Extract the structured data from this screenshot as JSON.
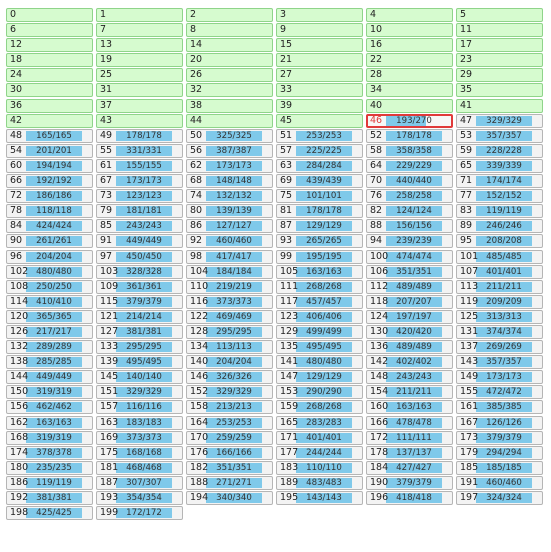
{
  "colors": {
    "done_bg": "#d6fbcf",
    "done_border": "#8fd48a",
    "active_border": "#e03a3a",
    "bar_fill": "#7fc9ea",
    "cell_bg": "#f3f3f3"
  },
  "cells": [
    {
      "id": "0",
      "status": "done"
    },
    {
      "id": "1",
      "status": "done"
    },
    {
      "id": "2",
      "status": "done"
    },
    {
      "id": "3",
      "status": "done"
    },
    {
      "id": "4",
      "status": "done"
    },
    {
      "id": "5",
      "status": "done"
    },
    {
      "id": "6",
      "status": "done"
    },
    {
      "id": "7",
      "status": "done"
    },
    {
      "id": "8",
      "status": "done"
    },
    {
      "id": "9",
      "status": "done"
    },
    {
      "id": "10",
      "status": "done"
    },
    {
      "id": "11",
      "status": "done"
    },
    {
      "id": "12",
      "status": "done"
    },
    {
      "id": "13",
      "status": "done"
    },
    {
      "id": "14",
      "status": "done"
    },
    {
      "id": "15",
      "status": "done"
    },
    {
      "id": "16",
      "status": "done"
    },
    {
      "id": "17",
      "status": "done"
    },
    {
      "id": "18",
      "status": "done"
    },
    {
      "id": "19",
      "status": "done"
    },
    {
      "id": "20",
      "status": "done"
    },
    {
      "id": "21",
      "status": "done"
    },
    {
      "id": "22",
      "status": "done"
    },
    {
      "id": "23",
      "status": "done"
    },
    {
      "id": "24",
      "status": "done"
    },
    {
      "id": "25",
      "status": "done"
    },
    {
      "id": "26",
      "status": "done"
    },
    {
      "id": "27",
      "status": "done"
    },
    {
      "id": "28",
      "status": "done"
    },
    {
      "id": "29",
      "status": "done"
    },
    {
      "id": "30",
      "status": "done"
    },
    {
      "id": "31",
      "status": "done"
    },
    {
      "id": "32",
      "status": "done"
    },
    {
      "id": "33",
      "status": "done"
    },
    {
      "id": "34",
      "status": "done"
    },
    {
      "id": "35",
      "status": "done"
    },
    {
      "id": "36",
      "status": "done"
    },
    {
      "id": "37",
      "status": "done"
    },
    {
      "id": "38",
      "status": "done"
    },
    {
      "id": "39",
      "status": "done"
    },
    {
      "id": "40",
      "status": "done"
    },
    {
      "id": "41",
      "status": "done"
    },
    {
      "id": "42",
      "status": "done"
    },
    {
      "id": "43",
      "status": "done"
    },
    {
      "id": "44",
      "status": "done"
    },
    {
      "id": "45",
      "status": "done"
    },
    {
      "id": "46",
      "status": "active",
      "progress": "193/270"
    },
    {
      "id": "47",
      "status": "pending",
      "progress": "329/329"
    },
    {
      "id": "48",
      "status": "pending",
      "progress": "165/165"
    },
    {
      "id": "49",
      "status": "pending",
      "progress": "178/178"
    },
    {
      "id": "50",
      "status": "pending",
      "progress": "325/325"
    },
    {
      "id": "51",
      "status": "pending",
      "progress": "253/253"
    },
    {
      "id": "52",
      "status": "pending",
      "progress": "178/178"
    },
    {
      "id": "53",
      "status": "pending",
      "progress": "357/357"
    },
    {
      "id": "54",
      "status": "pending",
      "progress": "201/201"
    },
    {
      "id": "55",
      "status": "pending",
      "progress": "331/331"
    },
    {
      "id": "56",
      "status": "pending",
      "progress": "387/387"
    },
    {
      "id": "57",
      "status": "pending",
      "progress": "225/225"
    },
    {
      "id": "58",
      "status": "pending",
      "progress": "358/358"
    },
    {
      "id": "59",
      "status": "pending",
      "progress": "228/228"
    },
    {
      "id": "60",
      "status": "pending",
      "progress": "194/194"
    },
    {
      "id": "61",
      "status": "pending",
      "progress": "155/155"
    },
    {
      "id": "62",
      "status": "pending",
      "progress": "173/173"
    },
    {
      "id": "63",
      "status": "pending",
      "progress": "284/284"
    },
    {
      "id": "64",
      "status": "pending",
      "progress": "229/229"
    },
    {
      "id": "65",
      "status": "pending",
      "progress": "339/339"
    },
    {
      "id": "66",
      "status": "pending",
      "progress": "192/192"
    },
    {
      "id": "67",
      "status": "pending",
      "progress": "173/173"
    },
    {
      "id": "68",
      "status": "pending",
      "progress": "148/148"
    },
    {
      "id": "69",
      "status": "pending",
      "progress": "439/439"
    },
    {
      "id": "70",
      "status": "pending",
      "progress": "440/440"
    },
    {
      "id": "71",
      "status": "pending",
      "progress": "174/174"
    },
    {
      "id": "72",
      "status": "pending",
      "progress": "186/186"
    },
    {
      "id": "73",
      "status": "pending",
      "progress": "123/123"
    },
    {
      "id": "74",
      "status": "pending",
      "progress": "132/132"
    },
    {
      "id": "75",
      "status": "pending",
      "progress": "101/101"
    },
    {
      "id": "76",
      "status": "pending",
      "progress": "258/258"
    },
    {
      "id": "77",
      "status": "pending",
      "progress": "152/152"
    },
    {
      "id": "78",
      "status": "pending",
      "progress": "118/118"
    },
    {
      "id": "79",
      "status": "pending",
      "progress": "181/181"
    },
    {
      "id": "80",
      "status": "pending",
      "progress": "139/139"
    },
    {
      "id": "81",
      "status": "pending",
      "progress": "178/178"
    },
    {
      "id": "82",
      "status": "pending",
      "progress": "124/124"
    },
    {
      "id": "83",
      "status": "pending",
      "progress": "119/119"
    },
    {
      "id": "84",
      "status": "pending",
      "progress": "424/424"
    },
    {
      "id": "85",
      "status": "pending",
      "progress": "243/243"
    },
    {
      "id": "86",
      "status": "pending",
      "progress": "127/127"
    },
    {
      "id": "87",
      "status": "pending",
      "progress": "129/129"
    },
    {
      "id": "88",
      "status": "pending",
      "progress": "156/156"
    },
    {
      "id": "89",
      "status": "pending",
      "progress": "246/246"
    },
    {
      "id": "90",
      "status": "pending",
      "progress": "261/261"
    },
    {
      "id": "91",
      "status": "pending",
      "progress": "449/449"
    },
    {
      "id": "92",
      "status": "pending",
      "progress": "460/460"
    },
    {
      "id": "93",
      "status": "pending",
      "progress": "265/265"
    },
    {
      "id": "94",
      "status": "pending",
      "progress": "239/239"
    },
    {
      "id": "95",
      "status": "pending",
      "progress": "208/208"
    },
    {
      "id": "96",
      "status": "pending",
      "progress": "204/204"
    },
    {
      "id": "97",
      "status": "pending",
      "progress": "450/450"
    },
    {
      "id": "98",
      "status": "pending",
      "progress": "417/417"
    },
    {
      "id": "99",
      "status": "pending",
      "progress": "195/195"
    },
    {
      "id": "100",
      "status": "pending",
      "progress": "474/474"
    },
    {
      "id": "101",
      "status": "pending",
      "progress": "485/485"
    },
    {
      "id": "102",
      "status": "pending",
      "progress": "480/480"
    },
    {
      "id": "103",
      "status": "pending",
      "progress": "328/328"
    },
    {
      "id": "104",
      "status": "pending",
      "progress": "184/184"
    },
    {
      "id": "105",
      "status": "pending",
      "progress": "163/163"
    },
    {
      "id": "106",
      "status": "pending",
      "progress": "351/351"
    },
    {
      "id": "107",
      "status": "pending",
      "progress": "401/401"
    },
    {
      "id": "108",
      "status": "pending",
      "progress": "250/250"
    },
    {
      "id": "109",
      "status": "pending",
      "progress": "361/361"
    },
    {
      "id": "110",
      "status": "pending",
      "progress": "219/219"
    },
    {
      "id": "111",
      "status": "pending",
      "progress": "268/268"
    },
    {
      "id": "112",
      "status": "pending",
      "progress": "489/489"
    },
    {
      "id": "113",
      "status": "pending",
      "progress": "211/211"
    },
    {
      "id": "114",
      "status": "pending",
      "progress": "410/410"
    },
    {
      "id": "115",
      "status": "pending",
      "progress": "379/379"
    },
    {
      "id": "116",
      "status": "pending",
      "progress": "373/373"
    },
    {
      "id": "117",
      "status": "pending",
      "progress": "457/457"
    },
    {
      "id": "118",
      "status": "pending",
      "progress": "207/207"
    },
    {
      "id": "119",
      "status": "pending",
      "progress": "209/209"
    },
    {
      "id": "120",
      "status": "pending",
      "progress": "365/365"
    },
    {
      "id": "121",
      "status": "pending",
      "progress": "214/214"
    },
    {
      "id": "122",
      "status": "pending",
      "progress": "469/469"
    },
    {
      "id": "123",
      "status": "pending",
      "progress": "406/406"
    },
    {
      "id": "124",
      "status": "pending",
      "progress": "197/197"
    },
    {
      "id": "125",
      "status": "pending",
      "progress": "313/313"
    },
    {
      "id": "126",
      "status": "pending",
      "progress": "217/217"
    },
    {
      "id": "127",
      "status": "pending",
      "progress": "381/381"
    },
    {
      "id": "128",
      "status": "pending",
      "progress": "295/295"
    },
    {
      "id": "129",
      "status": "pending",
      "progress": "499/499"
    },
    {
      "id": "130",
      "status": "pending",
      "progress": "420/420"
    },
    {
      "id": "131",
      "status": "pending",
      "progress": "374/374"
    },
    {
      "id": "132",
      "status": "pending",
      "progress": "289/289"
    },
    {
      "id": "133",
      "status": "pending",
      "progress": "295/295"
    },
    {
      "id": "134",
      "status": "pending",
      "progress": "113/113"
    },
    {
      "id": "135",
      "status": "pending",
      "progress": "495/495"
    },
    {
      "id": "136",
      "status": "pending",
      "progress": "489/489"
    },
    {
      "id": "137",
      "status": "pending",
      "progress": "269/269"
    },
    {
      "id": "138",
      "status": "pending",
      "progress": "285/285"
    },
    {
      "id": "139",
      "status": "pending",
      "progress": "495/495"
    },
    {
      "id": "140",
      "status": "pending",
      "progress": "204/204"
    },
    {
      "id": "141",
      "status": "pending",
      "progress": "480/480"
    },
    {
      "id": "142",
      "status": "pending",
      "progress": "402/402"
    },
    {
      "id": "143",
      "status": "pending",
      "progress": "357/357"
    },
    {
      "id": "144",
      "status": "pending",
      "progress": "449/449"
    },
    {
      "id": "145",
      "status": "pending",
      "progress": "140/140"
    },
    {
      "id": "146",
      "status": "pending",
      "progress": "326/326"
    },
    {
      "id": "147",
      "status": "pending",
      "progress": "129/129"
    },
    {
      "id": "148",
      "status": "pending",
      "progress": "243/243"
    },
    {
      "id": "149",
      "status": "pending",
      "progress": "173/173"
    },
    {
      "id": "150",
      "status": "pending",
      "progress": "319/319"
    },
    {
      "id": "151",
      "status": "pending",
      "progress": "329/329"
    },
    {
      "id": "152",
      "status": "pending",
      "progress": "329/329"
    },
    {
      "id": "153",
      "status": "pending",
      "progress": "290/290"
    },
    {
      "id": "154",
      "status": "pending",
      "progress": "211/211"
    },
    {
      "id": "155",
      "status": "pending",
      "progress": "472/472"
    },
    {
      "id": "156",
      "status": "pending",
      "progress": "462/462"
    },
    {
      "id": "157",
      "status": "pending",
      "progress": "116/116"
    },
    {
      "id": "158",
      "status": "pending",
      "progress": "213/213"
    },
    {
      "id": "159",
      "status": "pending",
      "progress": "268/268"
    },
    {
      "id": "160",
      "status": "pending",
      "progress": "163/163"
    },
    {
      "id": "161",
      "status": "pending",
      "progress": "385/385"
    },
    {
      "id": "162",
      "status": "pending",
      "progress": "163/163"
    },
    {
      "id": "163",
      "status": "pending",
      "progress": "183/183"
    },
    {
      "id": "164",
      "status": "pending",
      "progress": "253/253"
    },
    {
      "id": "165",
      "status": "pending",
      "progress": "283/283"
    },
    {
      "id": "166",
      "status": "pending",
      "progress": "478/478"
    },
    {
      "id": "167",
      "status": "pending",
      "progress": "126/126"
    },
    {
      "id": "168",
      "status": "pending",
      "progress": "319/319"
    },
    {
      "id": "169",
      "status": "pending",
      "progress": "373/373"
    },
    {
      "id": "170",
      "status": "pending",
      "progress": "259/259"
    },
    {
      "id": "171",
      "status": "pending",
      "progress": "401/401"
    },
    {
      "id": "172",
      "status": "pending",
      "progress": "111/111"
    },
    {
      "id": "173",
      "status": "pending",
      "progress": "379/379"
    },
    {
      "id": "174",
      "status": "pending",
      "progress": "378/378"
    },
    {
      "id": "175",
      "status": "pending",
      "progress": "168/168"
    },
    {
      "id": "176",
      "status": "pending",
      "progress": "166/166"
    },
    {
      "id": "177",
      "status": "pending",
      "progress": "244/244"
    },
    {
      "id": "178",
      "status": "pending",
      "progress": "137/137"
    },
    {
      "id": "179",
      "status": "pending",
      "progress": "294/294"
    },
    {
      "id": "180",
      "status": "pending",
      "progress": "235/235"
    },
    {
      "id": "181",
      "status": "pending",
      "progress": "468/468"
    },
    {
      "id": "182",
      "status": "pending",
      "progress": "351/351"
    },
    {
      "id": "183",
      "status": "pending",
      "progress": "110/110"
    },
    {
      "id": "184",
      "status": "pending",
      "progress": "427/427"
    },
    {
      "id": "185",
      "status": "pending",
      "progress": "185/185"
    },
    {
      "id": "186",
      "status": "pending",
      "progress": "119/119"
    },
    {
      "id": "187",
      "status": "pending",
      "progress": "307/307"
    },
    {
      "id": "188",
      "status": "pending",
      "progress": "271/271"
    },
    {
      "id": "189",
      "status": "pending",
      "progress": "483/483"
    },
    {
      "id": "190",
      "status": "pending",
      "progress": "379/379"
    },
    {
      "id": "191",
      "status": "pending",
      "progress": "460/460"
    },
    {
      "id": "192",
      "status": "pending",
      "progress": "381/381"
    },
    {
      "id": "193",
      "status": "pending",
      "progress": "354/354"
    },
    {
      "id": "194",
      "status": "pending",
      "progress": "340/340"
    },
    {
      "id": "195",
      "status": "pending",
      "progress": "143/143"
    },
    {
      "id": "196",
      "status": "pending",
      "progress": "418/418"
    },
    {
      "id": "197",
      "status": "pending",
      "progress": "324/324"
    },
    {
      "id": "198",
      "status": "pending",
      "progress": "425/425"
    },
    {
      "id": "199",
      "status": "pending",
      "progress": "172/172"
    }
  ]
}
